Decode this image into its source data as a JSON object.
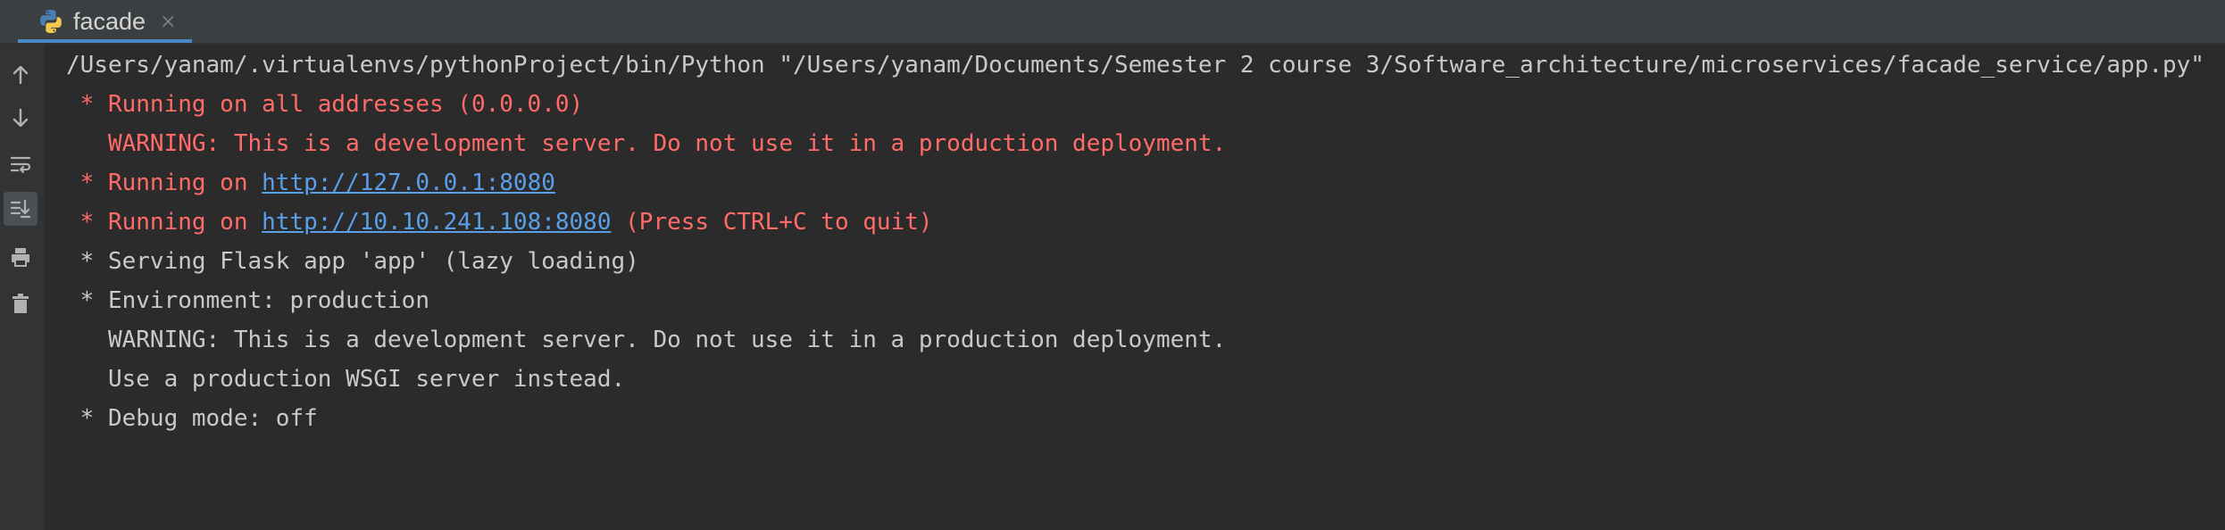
{
  "tab": {
    "title": "facade",
    "close_glyph": "×",
    "icon": "python-icon"
  },
  "toolbar": {
    "icons": [
      "arrow-up-icon",
      "arrow-down-icon",
      "soft-wrap-icon",
      "scroll-to-end-icon",
      "print-icon",
      "trash-icon"
    ],
    "active": "scroll-to-end-icon"
  },
  "console": {
    "command": "/Users/yanam/.virtualenvs/pythonProject/bin/Python \"/Users/yanam/Documents/Semester 2 course 3/Software_architecture/microservices/facade_service/app.py\"",
    "line1": " * Running on all addresses (0.0.0.0)",
    "line2": "   WARNING: This is a development server. Do not use it in a production deployment.",
    "line3_prefix": " * Running on ",
    "line3_link": "http://127.0.0.1:8080",
    "line4_prefix": " * Running on ",
    "line4_link": "http://10.10.241.108:8080",
    "line4_suffix": " (Press CTRL+C to quit)",
    "line5": " * Serving Flask app 'app' (lazy loading)",
    "line6": " * Environment: production",
    "line7": "   WARNING: This is a development server. Do not use it in a production deployment.",
    "line8": "   Use a production WSGI server instead.",
    "line9": " * Debug mode: off"
  },
  "colors": {
    "background": "#2b2b2b",
    "stderr": "#ff6b68",
    "stdout": "#c9c9c9",
    "link": "#5a9fe8",
    "tab_accent": "#4a88c7"
  }
}
